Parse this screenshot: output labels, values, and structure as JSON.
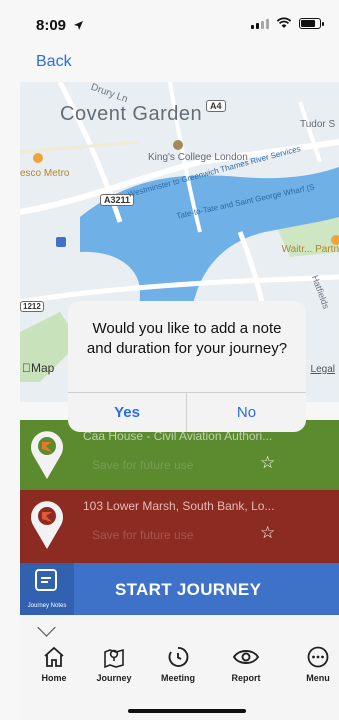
{
  "status_bar": {
    "time": "8:09",
    "location_arrow": "location-arrow-icon",
    "icons": [
      "signal-icon",
      "wifi-icon",
      "battery-icon"
    ]
  },
  "nav": {
    "back_label": "Back"
  },
  "map": {
    "area_label": "Covent Garden",
    "kings_college": "King's College London",
    "tudor": "Tudor S",
    "esco_metro": "esco Metro",
    "road_a4": "A4",
    "road_a3211": "A3211",
    "road_1212": "1212",
    "road_drury": "Drury Ln",
    "road_westminster": "Westminster to Greenwich Thames River Services",
    "river_tate": "Tate-to-Tate and Saint George Wharf (S",
    "waitrose": "Waitr... Partn",
    "hatfields": "Hatfields",
    "maps_logo": "Map",
    "legal": "Legal",
    "water_color": "#6fb0e6",
    "land_color": "#e9eef2",
    "park_color": "#bfe0b0"
  },
  "dialog": {
    "message": "Would you like to add a note and duration for your journey?",
    "yes_label": "Yes",
    "no_label": "No",
    "accent": "#2c6ce6"
  },
  "cards": [
    {
      "title": "Caa House - Civil Aviation Authori...",
      "subtitle": "Save for future use",
      "color": "#5b8a2f",
      "star_icon": "star-outline-icon"
    },
    {
      "title": "103 Lower Marsh, South Bank, Lo...",
      "subtitle": "Save for future use",
      "color": "#8b2b22",
      "star_icon": "star-outline-icon"
    }
  ],
  "start_bar": {
    "label": "START JOURNEY",
    "notes_label": "Journey Notes",
    "color": "#3e72c9"
  },
  "tabs": [
    {
      "label": "Home",
      "icon": "home-icon"
    },
    {
      "label": "Journey",
      "icon": "map-pin-icon"
    },
    {
      "label": "Meeting",
      "icon": "timer-icon"
    },
    {
      "label": "Report",
      "icon": "eye-icon"
    },
    {
      "label": "Menu",
      "icon": "more-icon"
    }
  ]
}
